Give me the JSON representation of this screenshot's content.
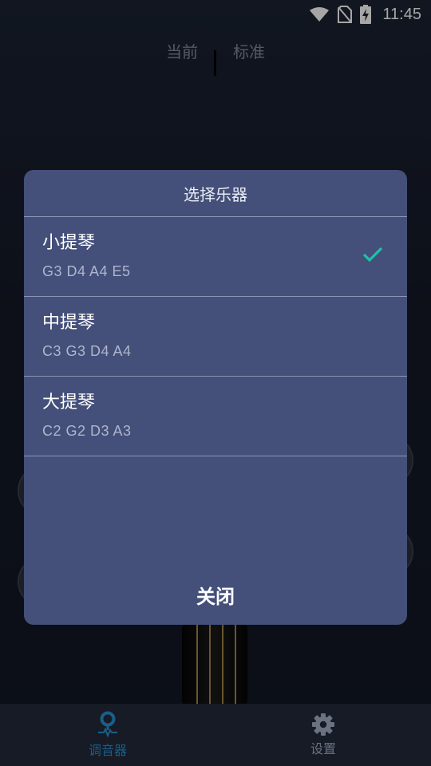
{
  "status_bar": {
    "time": "11:45",
    "icons": [
      "wifi-icon",
      "no-sim-icon",
      "battery-charging-icon"
    ]
  },
  "header": {
    "segments": [
      "当前",
      "标准"
    ]
  },
  "dialog": {
    "title": "选择乐器",
    "options": [
      {
        "name": "小提琴",
        "notes": "G3  D4  A4  E5",
        "selected": true
      },
      {
        "name": "中提琴",
        "notes": "C3 G3  D4  A4",
        "selected": false
      },
      {
        "name": "大提琴",
        "notes": "C2 G2  D3  A3",
        "selected": false
      }
    ],
    "close_label": "关闭"
  },
  "bottom_nav": {
    "items": [
      {
        "label": "调音器",
        "icon": "tuner-pin-icon",
        "active": true
      },
      {
        "label": "设置",
        "icon": "gear-icon",
        "active": false
      }
    ]
  },
  "colors": {
    "dialog_bg": "#44507a",
    "check": "#1fc0a8",
    "nav_active": "#1b5e88"
  }
}
